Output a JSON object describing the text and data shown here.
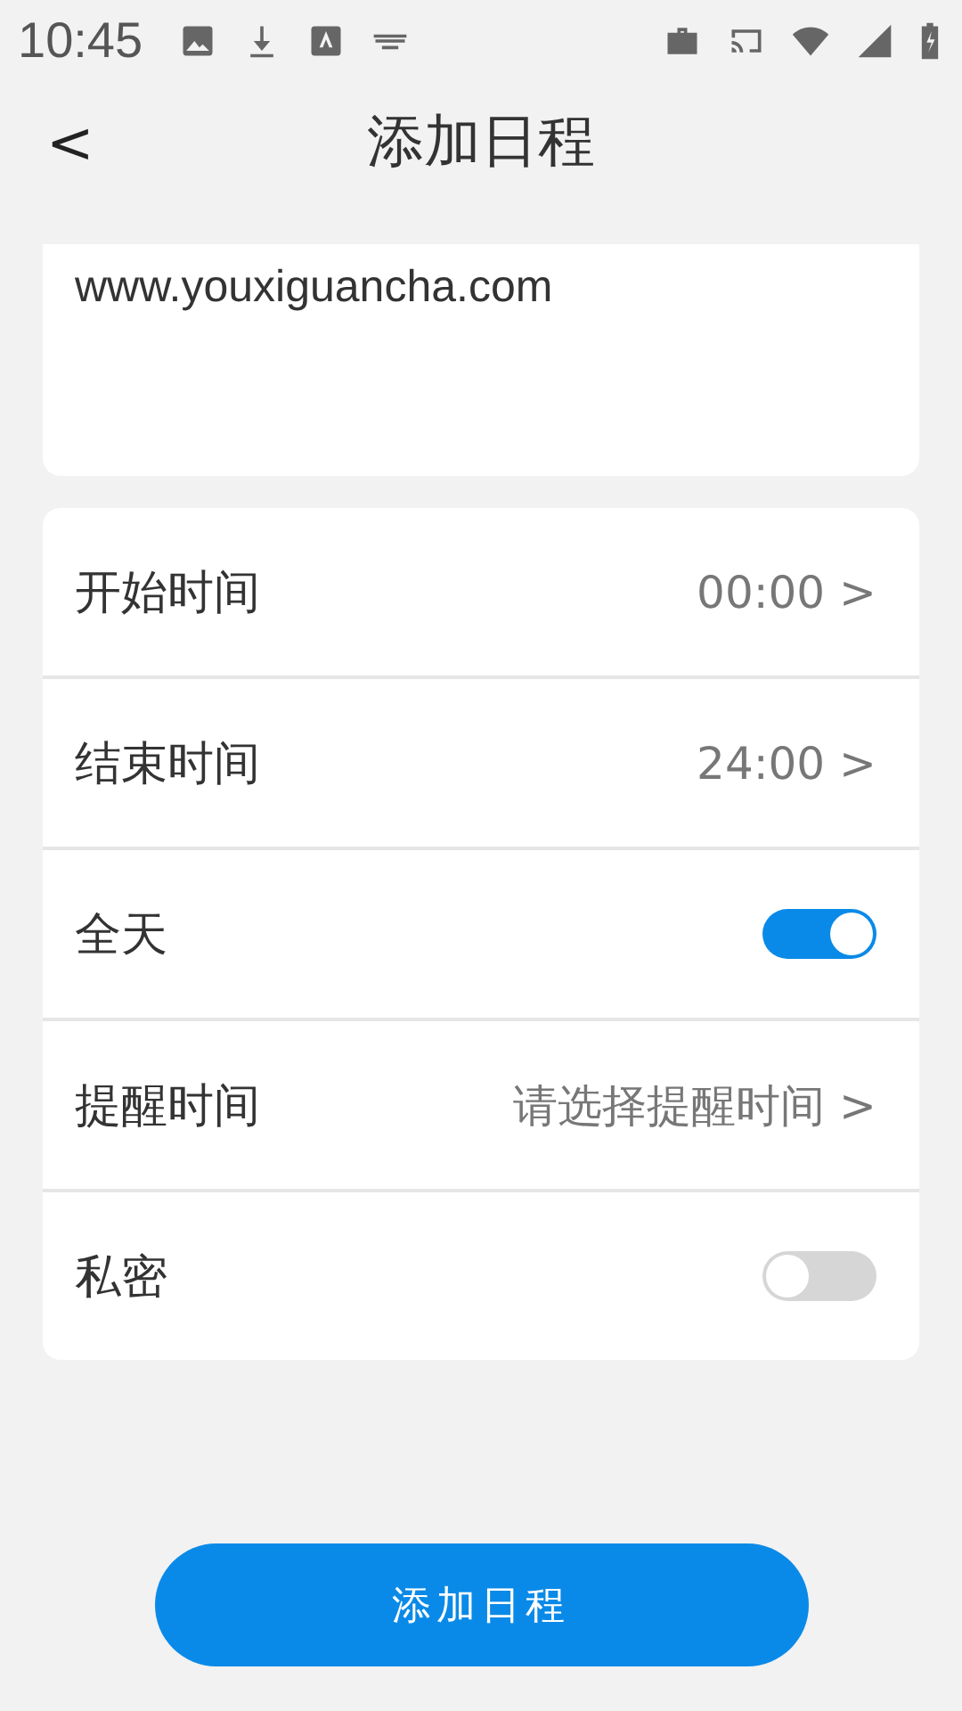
{
  "status_bar": {
    "time": "10:45"
  },
  "header": {
    "back": "<",
    "title": "添加日程"
  },
  "note": {
    "value": "www.youxiguancha.com"
  },
  "rows": [
    {
      "kind": "value",
      "label": "开始时间",
      "value": "00:00 >"
    },
    {
      "kind": "value",
      "label": "结束时间",
      "value": "24:00 >"
    },
    {
      "kind": "toggle",
      "label": "全天",
      "on": true
    },
    {
      "kind": "value",
      "label": "提醒时间",
      "value": "请选择提醒时间 >"
    },
    {
      "kind": "toggle",
      "label": "私密",
      "on": false
    }
  ],
  "submit": "添加日程"
}
